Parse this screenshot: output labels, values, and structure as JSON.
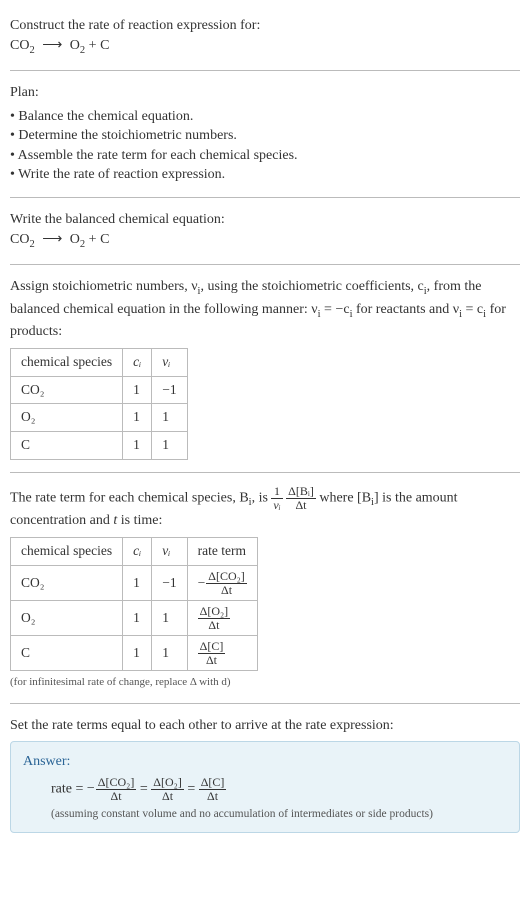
{
  "header": {
    "prompt": "Construct the rate of reaction expression for:",
    "equation_lhs": "CO",
    "equation_lhs_sub": "2",
    "equation_arrow": "⟶",
    "equation_rhs1": "O",
    "equation_rhs1_sub": "2",
    "equation_plus": " + ",
    "equation_rhs2": "C"
  },
  "plan": {
    "title": "Plan:",
    "items": [
      "Balance the chemical equation.",
      "Determine the stoichiometric numbers.",
      "Assemble the rate term for each chemical species.",
      "Write the rate of reaction expression."
    ]
  },
  "balanced": {
    "title": "Write the balanced chemical equation:",
    "equation_lhs": "CO",
    "equation_lhs_sub": "2",
    "equation_arrow": "⟶",
    "equation_rhs1": "O",
    "equation_rhs1_sub": "2",
    "equation_plus": " + ",
    "equation_rhs2": "C"
  },
  "stoich": {
    "intro_a": "Assign stoichiometric numbers, ν",
    "intro_a_sub": "i",
    "intro_b": ", using the stoichiometric coefficients, c",
    "intro_b_sub": "i",
    "intro_c": ", from the balanced chemical equation in the following manner: ν",
    "intro_c_sub": "i",
    "intro_d": " = −c",
    "intro_d_sub": "i",
    "intro_e": " for reactants and ν",
    "intro_e_sub": "i",
    "intro_f": " = c",
    "intro_f_sub": "i",
    "intro_g": " for products:",
    "headers": {
      "species": "chemical species",
      "ci": "cᵢ",
      "vi": "νᵢ"
    },
    "rows": [
      {
        "species": "CO₂",
        "ci": "1",
        "vi": "−1"
      },
      {
        "species": "O₂",
        "ci": "1",
        "vi": "1"
      },
      {
        "species": "C",
        "ci": "1",
        "vi": "1"
      }
    ]
  },
  "rateterm": {
    "intro_a": "The rate term for each chemical species, B",
    "intro_a_sub": "i",
    "intro_b": ", is ",
    "frac1_num": "1",
    "frac1_den": "νᵢ",
    "frac2_num": "Δ[Bᵢ]",
    "frac2_den": "Δt",
    "intro_c": " where [B",
    "intro_c_sub": "i",
    "intro_d": "] is the amount concentration and ",
    "t_var": "t",
    "intro_e": " is time:",
    "headers": {
      "species": "chemical species",
      "ci": "cᵢ",
      "vi": "νᵢ",
      "rate": "rate term"
    },
    "rows": [
      {
        "species": "CO₂",
        "ci": "1",
        "vi": "−1",
        "neg": "−",
        "num": "Δ[CO₂]",
        "den": "Δt"
      },
      {
        "species": "O₂",
        "ci": "1",
        "vi": "1",
        "neg": "",
        "num": "Δ[O₂]",
        "den": "Δt"
      },
      {
        "species": "C",
        "ci": "1",
        "vi": "1",
        "neg": "",
        "num": "Δ[C]",
        "den": "Δt"
      }
    ],
    "note": "(for infinitesimal rate of change, replace Δ with d)"
  },
  "final": {
    "title": "Set the rate terms equal to each other to arrive at the rate expression:",
    "answer_label": "Answer:",
    "rate_label": "rate = ",
    "neg": "−",
    "t1_num": "Δ[CO₂]",
    "t1_den": "Δt",
    "eq": " = ",
    "t2_num": "Δ[O₂]",
    "t2_den": "Δt",
    "t3_num": "Δ[C]",
    "t3_den": "Δt",
    "note": "(assuming constant volume and no accumulation of intermediates or side products)"
  }
}
